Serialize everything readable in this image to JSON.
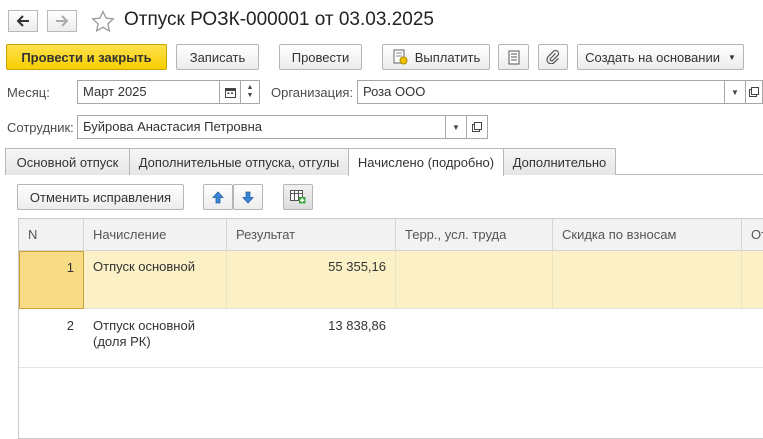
{
  "window": {
    "title": "Отпуск РОЗК-000001 от 03.03.2025"
  },
  "toolbar": {
    "post_and_close": "Провести и закрыть",
    "save": "Записать",
    "post": "Провести",
    "pay": "Выплатить",
    "create_based_on": "Создать на основании"
  },
  "form": {
    "month_label": "Месяц:",
    "month_value": "Март 2025",
    "org_label": "Организация:",
    "org_value": "Роза ООО",
    "employee_label": "Сотрудник:",
    "employee_value": "Буйрова Анастасия Петровна"
  },
  "tabs": [
    {
      "label": "Основной отпуск"
    },
    {
      "label": "Дополнительные отпуска, отгулы"
    },
    {
      "label": "Начислено (подробно)"
    },
    {
      "label": "Дополнительно"
    }
  ],
  "tab_toolbar": {
    "cancel_corrections": "Отменить исправления"
  },
  "table": {
    "columns": [
      "N",
      "Начисление",
      "Результат",
      "Терр., усл. труда",
      "Скидка по взносам",
      "От"
    ],
    "rows": [
      {
        "n": "1",
        "accrual": "Отпуск основной",
        "accrual_line2": "",
        "result": "55 355,16",
        "terr": "",
        "discount": ""
      },
      {
        "n": "2",
        "accrual": "Отпуск основной",
        "accrual_line2": "(доля РК)",
        "result": "13 838,86",
        "terr": "",
        "discount": ""
      }
    ]
  }
}
